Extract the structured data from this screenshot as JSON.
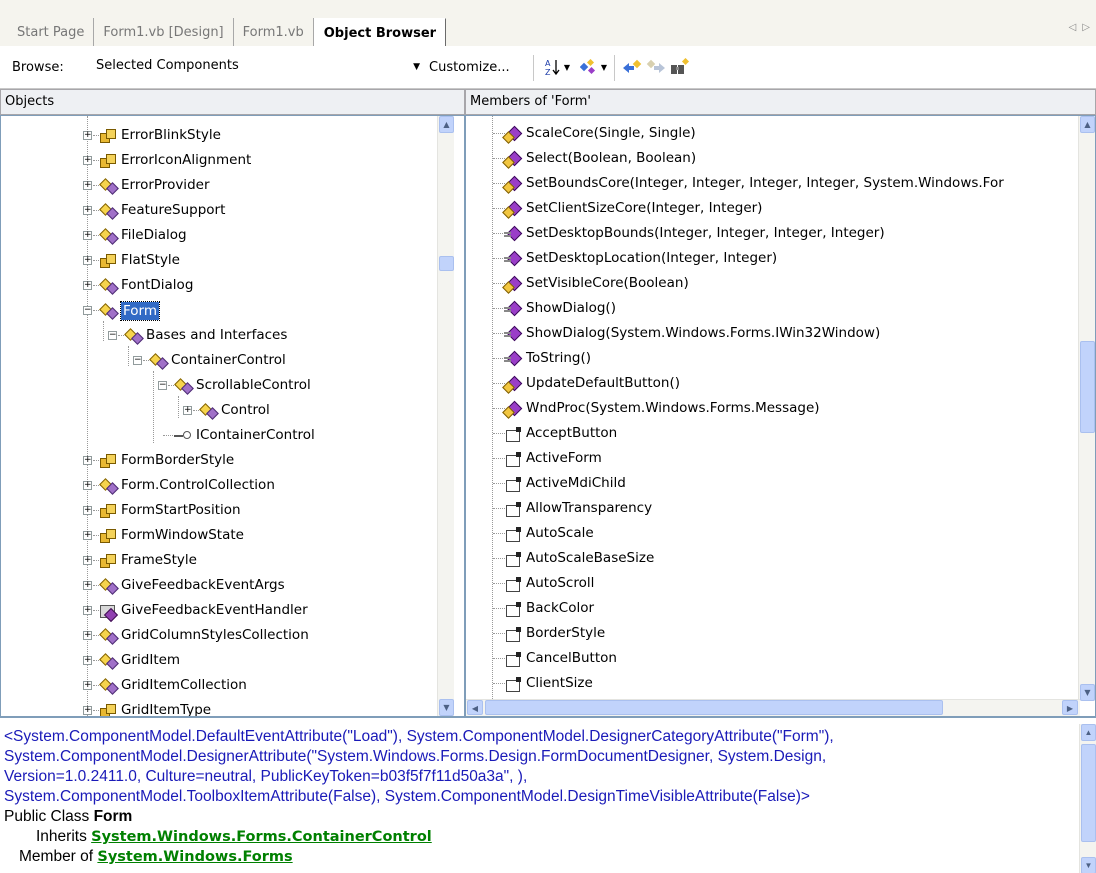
{
  "tabs": [
    {
      "label": "Start Page",
      "active": false
    },
    {
      "label": "Form1.vb [Design]",
      "active": false
    },
    {
      "label": "Form1.vb",
      "active": false
    },
    {
      "label": "Object Browser",
      "active": true
    }
  ],
  "toolbar": {
    "browse_label": "Browse:",
    "browse_value": "Selected Components",
    "customize_label": "Customize...",
    "icons": [
      "sort-icon",
      "dropdown-arrow-icon",
      "group-icon",
      "dropdown-arrow-icon",
      "back-icon",
      "forward-icon",
      "find-symbol-icon"
    ]
  },
  "objects_pane": {
    "header": "Objects",
    "items": [
      {
        "label": "ErrorBlinkStyle",
        "icon": "enum"
      },
      {
        "label": "ErrorIconAlignment",
        "icon": "enum"
      },
      {
        "label": "ErrorProvider",
        "icon": "class"
      },
      {
        "label": "FeatureSupport",
        "icon": "class"
      },
      {
        "label": "FileDialog",
        "icon": "class"
      },
      {
        "label": "FlatStyle",
        "icon": "enum"
      },
      {
        "label": "FontDialog",
        "icon": "class"
      },
      {
        "label": "Form",
        "icon": "class",
        "selected": true
      },
      {
        "label": "Bases and Interfaces",
        "icon": "class"
      },
      {
        "label": "ContainerControl",
        "icon": "class"
      },
      {
        "label": "ScrollableControl",
        "icon": "class"
      },
      {
        "label": "Control",
        "icon": "class"
      },
      {
        "label": "IContainerControl",
        "icon": "interface"
      },
      {
        "label": "FormBorderStyle",
        "icon": "enum"
      },
      {
        "label": "Form.ControlCollection",
        "icon": "class"
      },
      {
        "label": "FormStartPosition",
        "icon": "enum"
      },
      {
        "label": "FormWindowState",
        "icon": "enum"
      },
      {
        "label": "FrameStyle",
        "icon": "enum"
      },
      {
        "label": "GiveFeedbackEventArgs",
        "icon": "class"
      },
      {
        "label": "GiveFeedbackEventHandler",
        "icon": "delegate"
      },
      {
        "label": "GridColumnStylesCollection",
        "icon": "class"
      },
      {
        "label": "GridItem",
        "icon": "class"
      },
      {
        "label": "GridItemCollection",
        "icon": "class"
      },
      {
        "label": "GridItemType",
        "icon": "enum"
      }
    ]
  },
  "members_pane": {
    "header": "Members of 'Form'",
    "items": [
      {
        "label": "ScaleCore(Single, Single)",
        "icon": "method-protected"
      },
      {
        "label": "Select(Boolean, Boolean)",
        "icon": "method-protected"
      },
      {
        "label": "SetBoundsCore(Integer, Integer, Integer, Integer, System.Windows.For",
        "icon": "method-protected"
      },
      {
        "label": "SetClientSizeCore(Integer, Integer)",
        "icon": "method-protected"
      },
      {
        "label": "SetDesktopBounds(Integer, Integer, Integer, Integer)",
        "icon": "method-public"
      },
      {
        "label": "SetDesktopLocation(Integer, Integer)",
        "icon": "method-public"
      },
      {
        "label": "SetVisibleCore(Boolean)",
        "icon": "method-protected"
      },
      {
        "label": "ShowDialog()",
        "icon": "method-public"
      },
      {
        "label": "ShowDialog(System.Windows.Forms.IWin32Window)",
        "icon": "method-public"
      },
      {
        "label": "ToString()",
        "icon": "method-public"
      },
      {
        "label": "UpdateDefaultButton()",
        "icon": "method-protected"
      },
      {
        "label": "WndProc(System.Windows.Forms.Message)",
        "icon": "method-protected"
      },
      {
        "label": "AcceptButton",
        "icon": "property"
      },
      {
        "label": "ActiveForm",
        "icon": "property"
      },
      {
        "label": "ActiveMdiChild",
        "icon": "property"
      },
      {
        "label": "AllowTransparency",
        "icon": "property"
      },
      {
        "label": "AutoScale",
        "icon": "property"
      },
      {
        "label": "AutoScaleBaseSize",
        "icon": "property"
      },
      {
        "label": "AutoScroll",
        "icon": "property"
      },
      {
        "label": "BackColor",
        "icon": "property"
      },
      {
        "label": "BorderStyle",
        "icon": "property"
      },
      {
        "label": "CancelButton",
        "icon": "property"
      },
      {
        "label": "ClientSize",
        "icon": "property"
      }
    ]
  },
  "description": {
    "attr_line1": "<System.ComponentModel.DefaultEventAttribute(\"Load\"), System.ComponentModel.DesignerCategoryAttribute(\"Form\"),",
    "attr_line2": "System.ComponentModel.DesignerAttribute(\"System.Windows.Forms.Design.FormDocumentDesigner, System.Design,",
    "attr_line3": "Version=1.0.2411.0, Culture=neutral, PublicKeyToken=b03f5f7f11d50a3a\", ),",
    "attr_line4": "System.ComponentModel.ToolboxItemAttribute(False), System.ComponentModel.DesignTimeVisibleAttribute(False)>",
    "decl_prefix": "Public Class ",
    "decl_name": "Form",
    "inherits_label": "Inherits ",
    "inherits_link": "System.Windows.Forms.ContainerControl",
    "member_of_label": "Member of ",
    "member_of_link": "System.Windows.Forms"
  },
  "colors": {
    "selection": "#316ac5",
    "link_green": "#008000",
    "attribute_blue": "#1a1ab8",
    "scrollbar": "#c1d3fb"
  }
}
